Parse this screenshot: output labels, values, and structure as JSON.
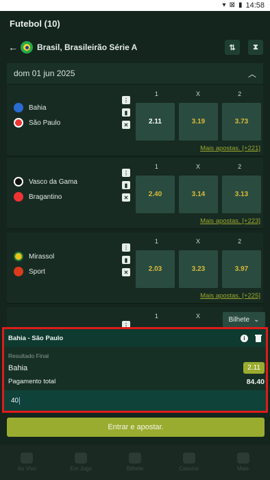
{
  "status": {
    "time": "14:58"
  },
  "header": {
    "title": "Futebol (10)"
  },
  "league": {
    "name": "Brasil, Brasileirão Série A"
  },
  "date_section": {
    "label": "dom 01 jun 2025"
  },
  "odds_labels": [
    "1",
    "X",
    "2"
  ],
  "matches": [
    {
      "home": "Bahia",
      "away": "São Paulo",
      "odds": [
        "2.11",
        "3.19",
        "3.73"
      ],
      "more": "Mais apostas. [+221]"
    },
    {
      "home": "Vasco da Gama",
      "away": "Bragantino",
      "odds": [
        "2.40",
        "3.14",
        "3.13"
      ],
      "more": "Mais apostas. [+223]"
    },
    {
      "home": "Mirassol",
      "away": "Sport",
      "odds": [
        "2.03",
        "3.23",
        "3.97"
      ],
      "more": "Mais apostas. [+225]"
    }
  ],
  "betslip": {
    "toggle_label": "Bilhete",
    "match": "Bahia - São Paulo",
    "market": "Resultado Final",
    "selection": "Bahia",
    "odd": "2.11",
    "total_label": "Pagamento total",
    "total_value": "84.40",
    "stake": "40",
    "cta": "Entrar e apostar."
  },
  "bottom_nav": [
    "Ao Vivo",
    "Em Jogo",
    "Bilhete",
    "Cassino",
    "Mais"
  ]
}
